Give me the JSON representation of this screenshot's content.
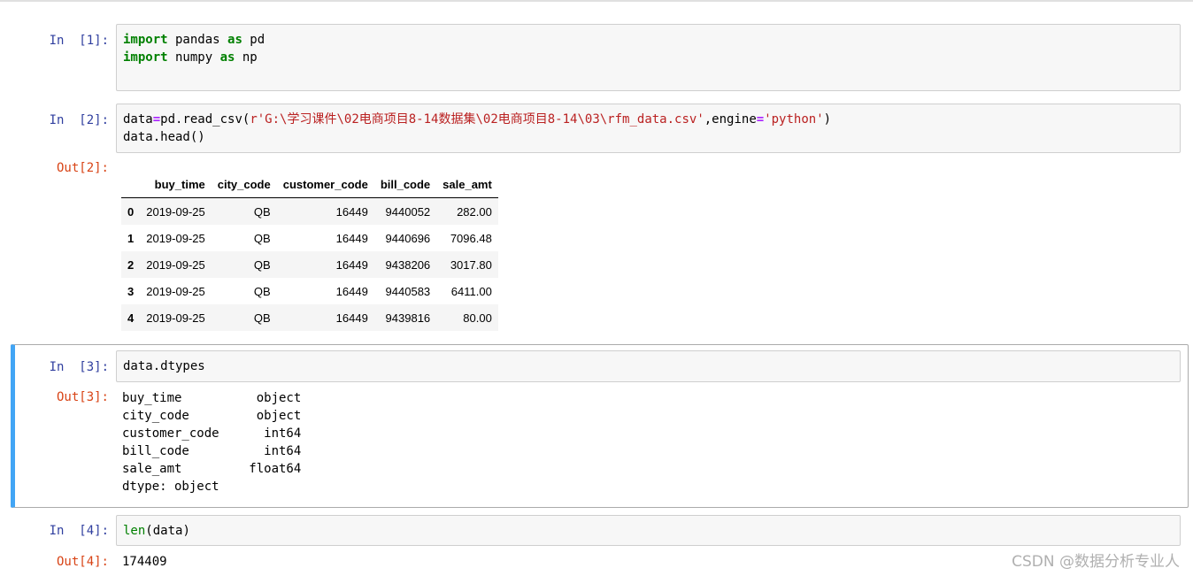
{
  "cells": [
    {
      "in_prompt": "In  [1]:",
      "code_lines": [
        [
          {
            "t": "import",
            "c": "kw"
          },
          {
            "t": " pandas ",
            "c": ""
          },
          {
            "t": "as",
            "c": "kw"
          },
          {
            "t": " pd",
            "c": ""
          }
        ],
        [
          {
            "t": "import",
            "c": "kw"
          },
          {
            "t": " numpy ",
            "c": ""
          },
          {
            "t": "as",
            "c": "kw"
          },
          {
            "t": " np",
            "c": ""
          }
        ]
      ]
    },
    {
      "in_prompt": "In  [2]:",
      "code_lines": [
        [
          {
            "t": "data",
            "c": ""
          },
          {
            "t": "=",
            "c": "op"
          },
          {
            "t": "pd.read_csv(",
            "c": ""
          },
          {
            "t": "r'G:\\学习课件\\02电商项目8-14数据集\\02电商项目8-14\\03\\rfm_data.csv'",
            "c": "str"
          },
          {
            "t": ",engine",
            "c": ""
          },
          {
            "t": "=",
            "c": "op"
          },
          {
            "t": "'python'",
            "c": "str"
          },
          {
            "t": ")",
            "c": ""
          }
        ],
        [
          {
            "t": "data.head()",
            "c": ""
          }
        ]
      ],
      "out_prompt": "Out[2]:",
      "table": {
        "columns": [
          "",
          "buy_time",
          "city_code",
          "customer_code",
          "bill_code",
          "sale_amt"
        ],
        "rows": [
          [
            "0",
            "2019-09-25",
            "QB",
            "16449",
            "9440052",
            "282.00"
          ],
          [
            "1",
            "2019-09-25",
            "QB",
            "16449",
            "9440696",
            "7096.48"
          ],
          [
            "2",
            "2019-09-25",
            "QB",
            "16449",
            "9438206",
            "3017.80"
          ],
          [
            "3",
            "2019-09-25",
            "QB",
            "16449",
            "9440583",
            "6411.00"
          ],
          [
            "4",
            "2019-09-25",
            "QB",
            "16449",
            "9439816",
            "80.00"
          ]
        ]
      }
    },
    {
      "in_prompt": "In  [3]:",
      "code_lines": [
        [
          {
            "t": "data.dtypes",
            "c": ""
          }
        ]
      ],
      "out_prompt": "Out[3]:",
      "output": "buy_time          object\ncity_code         object\ncustomer_code      int64\nbill_code          int64\nsale_amt         float64\ndtype: object"
    },
    {
      "in_prompt": "In  [4]:",
      "code_lines": [
        [
          {
            "t": "len",
            "c": "bi"
          },
          {
            "t": "(data)",
            "c": ""
          }
        ]
      ],
      "out_prompt": "Out[4]:",
      "output": "174409"
    }
  ],
  "watermark": "CSDN @数据分析专业人"
}
